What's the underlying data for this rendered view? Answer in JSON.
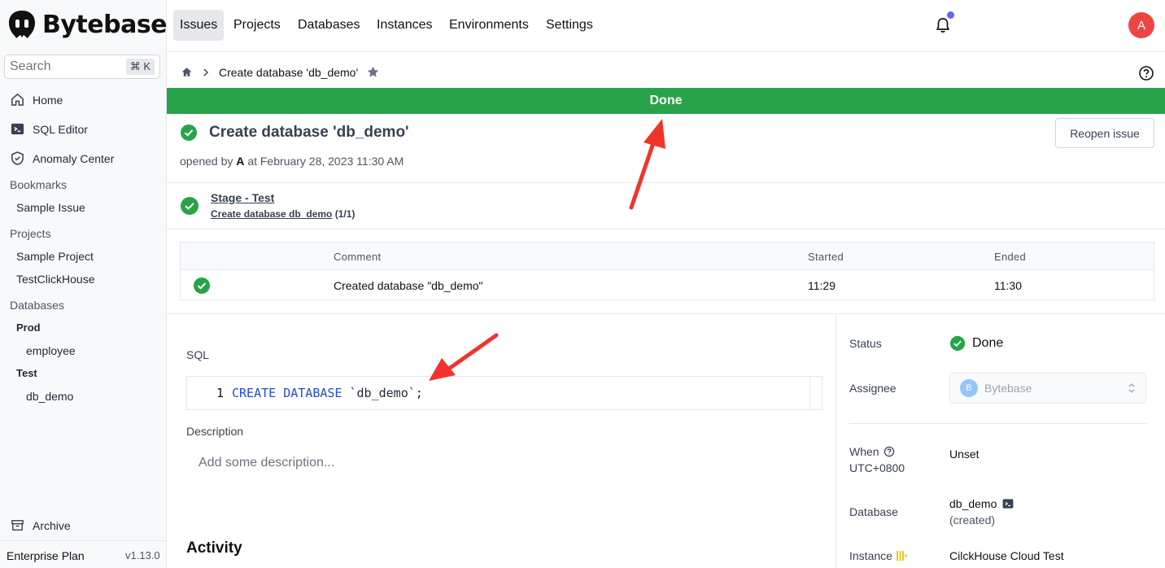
{
  "brand": {
    "name": "Bytebase"
  },
  "search": {
    "placeholder": "Search",
    "shortcut": "⌘ K"
  },
  "sidebar": {
    "nav": [
      {
        "label": "Home",
        "icon": "home-icon"
      },
      {
        "label": "SQL Editor",
        "icon": "terminal-icon"
      },
      {
        "label": "Anomaly Center",
        "icon": "shield-icon"
      }
    ],
    "bookmarks_label": "Bookmarks",
    "bookmarks": [
      "Sample Issue"
    ],
    "projects_label": "Projects",
    "projects": [
      "Sample Project",
      "TestClickHouse"
    ],
    "databases_label": "Databases",
    "env_prod": "Prod",
    "prod_dbs": [
      "employee"
    ],
    "env_test": "Test",
    "test_dbs": [
      "db_demo"
    ],
    "archive": "Archive",
    "plan": "Enterprise Plan",
    "version": "v1.13.0"
  },
  "topnav": {
    "tabs": [
      "Issues",
      "Projects",
      "Databases",
      "Instances",
      "Environments",
      "Settings"
    ],
    "active_tab": "Issues",
    "avatar_initial": "A"
  },
  "breadcrumb": {
    "title": "Create database 'db_demo'"
  },
  "banner": {
    "text": "Done",
    "color": "#29a34a"
  },
  "issue": {
    "title": "Create database 'db_demo'",
    "opened_prefix": "opened by",
    "opened_by": "A",
    "opened_at": "at February 28, 2023 11:30 AM",
    "reopen_label": "Reopen issue"
  },
  "stage": {
    "title": "Stage - Test",
    "task": "Create database db_demo",
    "progress": "(1/1)"
  },
  "task_table": {
    "headers": {
      "comment": "Comment",
      "started": "Started",
      "ended": "Ended"
    },
    "row": {
      "comment": "Created database \"db_demo\"",
      "started": "11:29",
      "ended": "11:30"
    }
  },
  "sql": {
    "label": "SQL",
    "line_no": "1",
    "keyword": "CREATE DATABASE",
    "rest": " `db_demo`;"
  },
  "description": {
    "label": "Description",
    "placeholder": "Add some description..."
  },
  "activity": {
    "label": "Activity"
  },
  "details": {
    "status_label": "Status",
    "status_value": "Done",
    "assignee_label": "Assignee",
    "assignee_initial": "B",
    "assignee_value": "Bytebase",
    "when_label": "When",
    "when_tz": "UTC+0800",
    "when_value": "Unset",
    "database_label": "Database",
    "database_value": "db_demo",
    "database_note": "(created)",
    "instance_label": "Instance",
    "instance_value": "CilckHouse Cloud Test"
  }
}
